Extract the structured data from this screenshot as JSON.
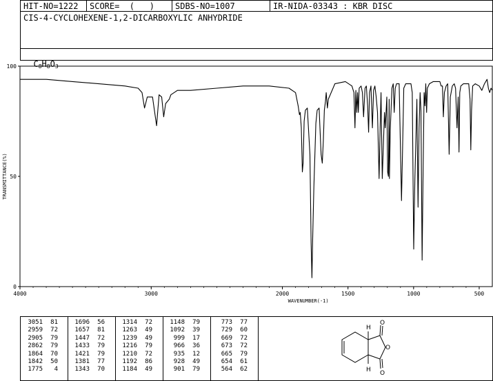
{
  "header": {
    "hit_no": "HIT-NO=1222",
    "score": "SCORE=  (   )",
    "sdbs_no": "SDBS-NO=1007",
    "ir_id": "IR-NIDA-03343 : KBR DISC",
    "compound": "CIS-4-CYCLOHEXENE-1,2-DICARBOXYLIC ANHYDRIDE",
    "formula_parts": [
      "C",
      "8",
      "H",
      "8",
      "O",
      "3"
    ]
  },
  "chart_data": {
    "type": "line",
    "xlabel": "WAVENUMBER(-1)",
    "ylabel": "TRANSMITTANCE(%)",
    "xlim": [
      4000,
      400
    ],
    "ylim": [
      0,
      100
    ],
    "x_ticks": [
      4000,
      3000,
      2000,
      1500,
      1000,
      500
    ],
    "x_tick_labels": [
      "4000",
      "3000",
      "2000",
      "1500",
      "1000",
      "500"
    ],
    "y_ticks": [
      0,
      50,
      100
    ],
    "y_tick_labels": [
      "0",
      "50",
      "100"
    ],
    "grid": false,
    "series": [
      {
        "x": [
          4000,
          3800,
          3600,
          3400,
          3200,
          3100,
          3070,
          3051,
          3030,
          2990,
          2959,
          2940,
          2920,
          2905,
          2890,
          2862,
          2850,
          2800,
          2700,
          2500,
          2300,
          2100,
          1950,
          1900,
          1880,
          1870,
          1864,
          1856,
          1848,
          1842,
          1834,
          1825,
          1810,
          1790,
          1781,
          1775,
          1769,
          1760,
          1745,
          1735,
          1720,
          1705,
          1696,
          1688,
          1680,
          1672,
          1666,
          1657,
          1650,
          1600,
          1520,
          1470,
          1455,
          1447,
          1440,
          1433,
          1427,
          1421,
          1415,
          1400,
          1390,
          1381,
          1370,
          1360,
          1350,
          1343,
          1336,
          1325,
          1314,
          1305,
          1295,
          1285,
          1275,
          1263,
          1255,
          1248,
          1239,
          1230,
          1222,
          1216,
          1210,
          1204,
          1198,
          1192,
          1186,
          1184,
          1178,
          1165,
          1155,
          1148,
          1140,
          1130,
          1110,
          1092,
          1085,
          1075,
          1060,
          1040,
          1020,
          1010,
          999,
          990,
          982,
          975,
          966,
          958,
          950,
          944,
          935,
          928,
          920,
          913,
          907,
          901,
          895,
          880,
          850,
          800,
          790,
          780,
          773,
          765,
          752,
          740,
          729,
          720,
          705,
          690,
          680,
          669,
          660,
          654,
          648,
          640,
          620,
          600,
          580,
          570,
          564,
          558,
          550,
          530,
          500,
          480,
          460,
          440,
          430,
          420,
          410,
          400
        ],
        "y": [
          94,
          94,
          93,
          92,
          91,
          90,
          88,
          81,
          86,
          86,
          73,
          87,
          86,
          77,
          83,
          85,
          87,
          89,
          89,
          90,
          91,
          91,
          90,
          88,
          82,
          78,
          79,
          72,
          52,
          56,
          75,
          80,
          81,
          60,
          20,
          4,
          22,
          45,
          74,
          80,
          81,
          60,
          56,
          66,
          80,
          84,
          88,
          81,
          85,
          92,
          93,
          91,
          88,
          72,
          89,
          79,
          88,
          79,
          90,
          91,
          88,
          77,
          90,
          91,
          82,
          70,
          88,
          91,
          72,
          89,
          91,
          86,
          79,
          49,
          72,
          88,
          49,
          65,
          79,
          72,
          79,
          86,
          52,
          50,
          85,
          49,
          71,
          90,
          92,
          79,
          90,
          92,
          92,
          39,
          60,
          90,
          92,
          92,
          92,
          88,
          17,
          49,
          68,
          85,
          36,
          72,
          88,
          80,
          12,
          49,
          88,
          82,
          92,
          79,
          90,
          92,
          93,
          93,
          91,
          91,
          77,
          88,
          91,
          92,
          60,
          86,
          91,
          92,
          90,
          72,
          86,
          61,
          88,
          91,
          92,
          92,
          92,
          85,
          62,
          80,
          91,
          92,
          91,
          89,
          92,
          94,
          90,
          88,
          90,
          89
        ]
      }
    ],
    "peak_table": [
      [
        "3051",
        "81"
      ],
      [
        "2959",
        "72"
      ],
      [
        "2905",
        "79"
      ],
      [
        "2862",
        "79"
      ],
      [
        "1864",
        "70"
      ],
      [
        "1842",
        "50"
      ],
      [
        "1775",
        "4"
      ],
      [
        "1696",
        "56"
      ],
      [
        "1657",
        "81"
      ],
      [
        "1447",
        "72"
      ],
      [
        "1433",
        "79"
      ],
      [
        "1421",
        "79"
      ],
      [
        "1381",
        "77"
      ],
      [
        "1343",
        "70"
      ],
      [
        "1314",
        "72"
      ],
      [
        "1263",
        "49"
      ],
      [
        "1239",
        "49"
      ],
      [
        "1216",
        "79"
      ],
      [
        "1210",
        "72"
      ],
      [
        "1192",
        "86"
      ],
      [
        "1184",
        "49"
      ],
      [
        "1148",
        "79"
      ],
      [
        "1092",
        "39"
      ],
      [
        "999",
        "17"
      ],
      [
        "966",
        "36"
      ],
      [
        "935",
        "12"
      ],
      [
        "928",
        "49"
      ],
      [
        "901",
        "79"
      ],
      [
        "773",
        "77"
      ],
      [
        "729",
        "60"
      ],
      [
        "669",
        "72"
      ],
      [
        "673",
        "72"
      ],
      [
        "665",
        "79"
      ],
      [
        "654",
        "61"
      ],
      [
        "564",
        "62"
      ]
    ]
  },
  "structure": {
    "labels": [
      "H",
      "O",
      "O",
      "O",
      "H"
    ]
  }
}
